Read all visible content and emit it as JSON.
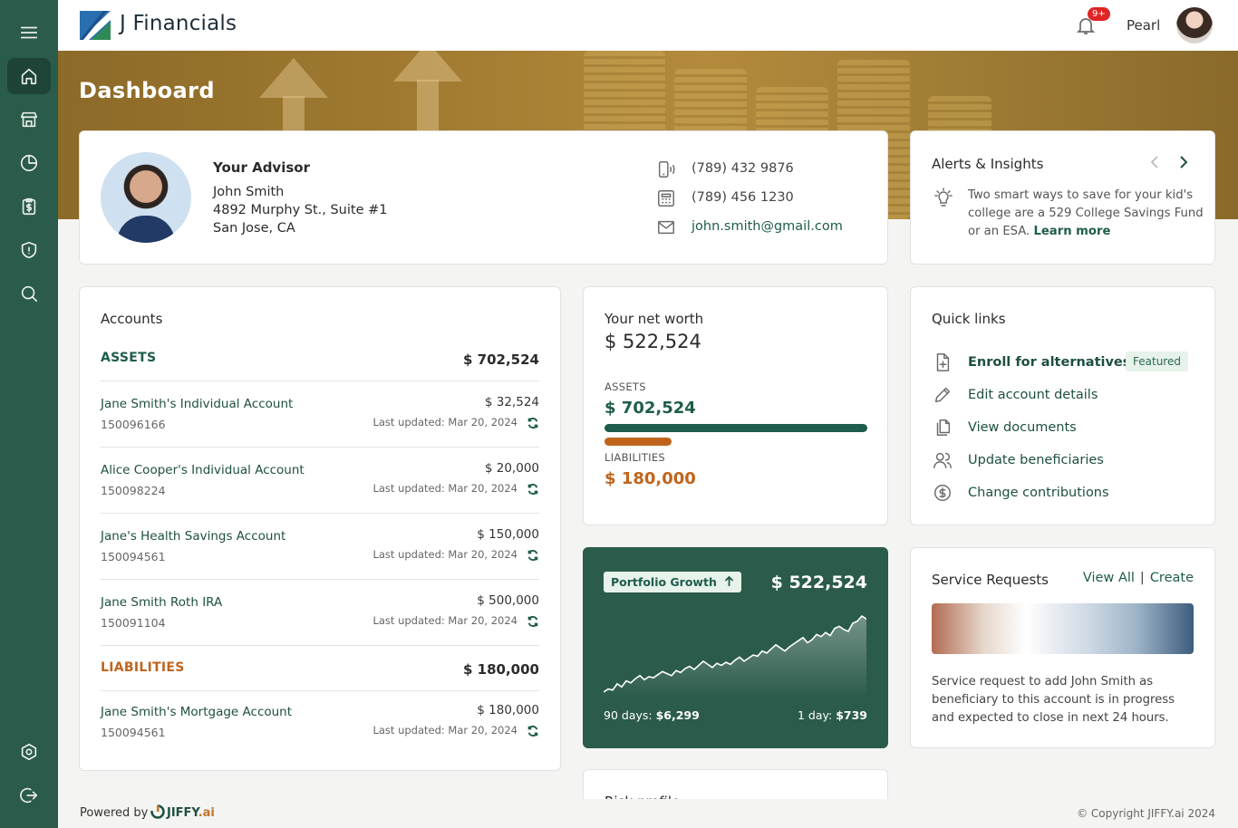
{
  "app": {
    "brand": "J Financials",
    "page_title": "Dashboard"
  },
  "topbar": {
    "notifications_badge": "9+",
    "user_name": "Pearl"
  },
  "sidebar": {
    "items": [
      {
        "icon": "menu-icon"
      },
      {
        "icon": "home-icon",
        "active": true
      },
      {
        "icon": "bank-icon"
      },
      {
        "icon": "pie-chart-icon"
      },
      {
        "icon": "clipboard-dollar-icon"
      },
      {
        "icon": "shield-icon"
      },
      {
        "icon": "search-icon"
      },
      {
        "icon": "settings-icon"
      },
      {
        "icon": "logout-icon"
      }
    ]
  },
  "advisor": {
    "title": "Your Advisor",
    "name": "John Smith",
    "address1": "4892 Murphy St., Suite #1",
    "address2": "San Jose, CA",
    "mobile": "(789) 432 9876",
    "office": "(789) 456 1230",
    "email": "john.smith@gmail.com"
  },
  "alerts": {
    "title": "Alerts & Insights",
    "text": "Two smart ways to save for your kid's college are a 529 College Savings Fund or an ESA.",
    "link": "Learn more"
  },
  "accounts": {
    "title": "Accounts",
    "assets_label": "ASSETS",
    "assets_total": "$ 702,524",
    "assets": [
      {
        "name": "Jane Smith's Individual Account",
        "number": "150096166",
        "amount": "$ 32,524",
        "updated": "Last updated: Mar 20, 2024"
      },
      {
        "name": "Alice Cooper's Individual Account",
        "number": "150098224",
        "amount": "$ 20,000",
        "updated": "Last updated: Mar 20, 2024"
      },
      {
        "name": "Jane's Health Savings Account",
        "number": "150094561",
        "amount": "$ 150,000",
        "updated": "Last updated: Mar 20, 2024"
      },
      {
        "name": "Jane Smith Roth IRA",
        "number": "150091104",
        "amount": "$ 500,000",
        "updated": "Last updated: Mar 20, 2024"
      }
    ],
    "liabilities_label": "LIABILITIES",
    "liabilities_total": "$ 180,000",
    "liabilities": [
      {
        "name": "Jane Smith's Mortgage Account",
        "number": "150094561",
        "amount": "$ 180,000",
        "updated": "Last updated: Mar 20, 2024"
      }
    ]
  },
  "networth": {
    "title": "Your net worth",
    "value": "$ 522,524",
    "assets_label": "ASSETS",
    "assets_value": "$ 702,524",
    "assets_fraction": 1.0,
    "liabilities_label": "LIABILITIES",
    "liabilities_value": "$ 180,000",
    "liabilities_fraction": 0.256,
    "colors": {
      "assets": "#1e5c4c",
      "liabilities": "#c0641c"
    }
  },
  "portfolio": {
    "pill": "Portfolio Growth",
    "value": "$ 522,524",
    "days90_label": "90 days:",
    "days90_value": "$6,299",
    "day1_label": "1 day:",
    "day1_value": "$739",
    "series": [
      12,
      18,
      16,
      28,
      22,
      34,
      30,
      38,
      44,
      36,
      42,
      40,
      46,
      52,
      48,
      44,
      54,
      50,
      58,
      62,
      56,
      64,
      72,
      66,
      60,
      68,
      64,
      70,
      66,
      74,
      80,
      72,
      78,
      84,
      82,
      92,
      88,
      96,
      104,
      98,
      92,
      100,
      106,
      112,
      118,
      108,
      114,
      124,
      120,
      128,
      122,
      136,
      140,
      134,
      130,
      146,
      150,
      160,
      154
    ]
  },
  "quick_links": {
    "title": "Quick links",
    "featured": "Featured",
    "items": [
      {
        "label": "Enroll for alternatives",
        "icon": "file-plus-icon"
      },
      {
        "label": "Edit account details",
        "icon": "pencil-icon"
      },
      {
        "label": "View documents",
        "icon": "documents-icon"
      },
      {
        "label": "Update beneficiaries",
        "icon": "users-icon"
      },
      {
        "label": "Change contributions",
        "icon": "dollar-circle-icon"
      }
    ]
  },
  "service": {
    "title": "Service Requests",
    "view_all": "View All",
    "separator": "|",
    "create": "Create",
    "text": "Service request to add John Smith as beneficiary to this account is in progress and expected to close in next 24 hours."
  },
  "risk": {
    "title": "Risk profile"
  },
  "footer": {
    "powered_by": "Powered by",
    "jiffy_brand": "JIFFY",
    "jiffy_suffix": ".ai",
    "copyright": "© Copyright JIFFY.ai 2024"
  }
}
